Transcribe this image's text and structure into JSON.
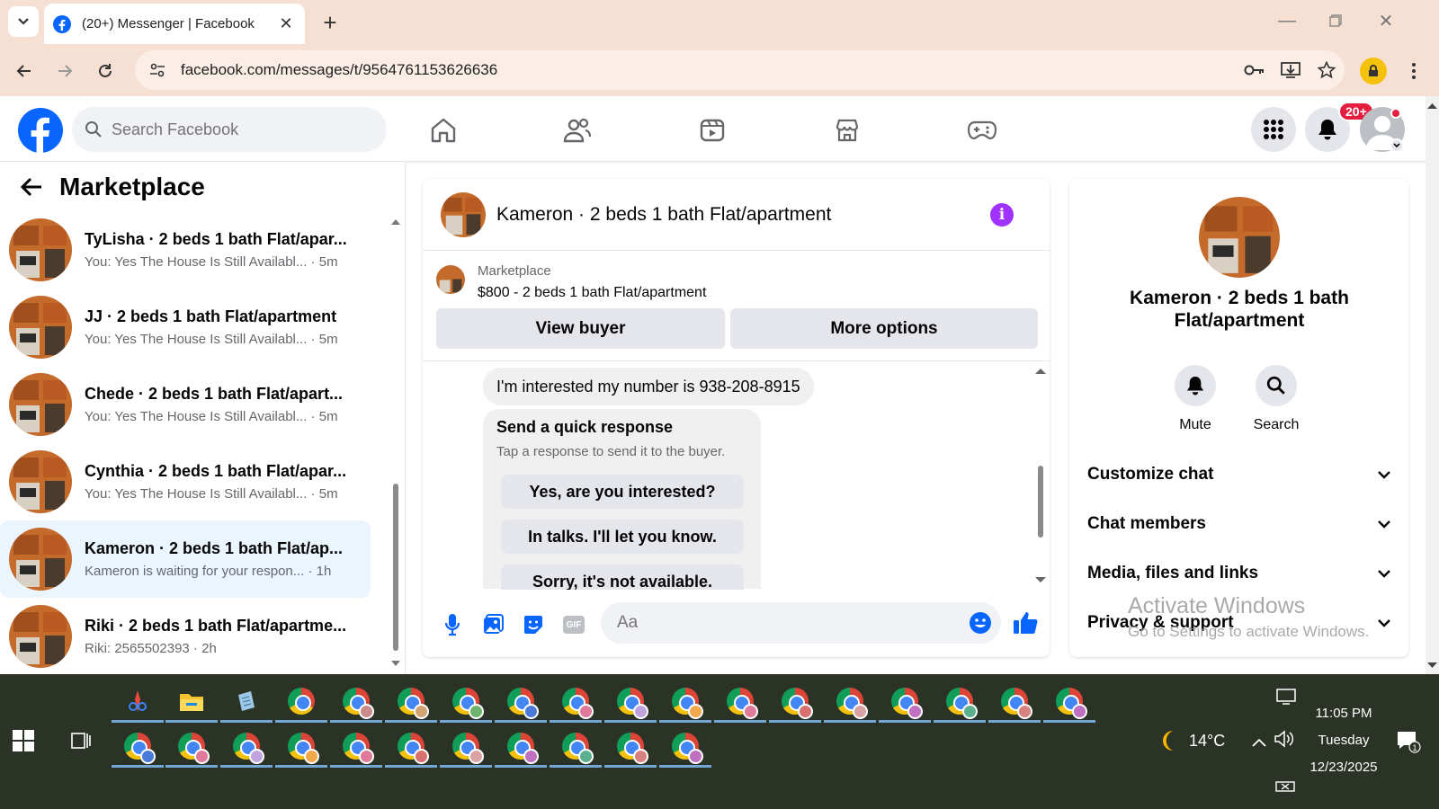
{
  "browser": {
    "tab_title": "(20+) Messenger | Facebook",
    "url": "facebook.com/messages/t/9564761153626636"
  },
  "fb_header": {
    "search_placeholder": "Search Facebook",
    "notification_badge": "20+"
  },
  "left_panel": {
    "title": "Marketplace",
    "conversations": [
      {
        "name": "TyLisha · 2 beds 1 bath Flat/apar...",
        "preview": "You: Yes The House Is Still Availabl...",
        "time": "5m"
      },
      {
        "name": "JJ · 2 beds 1 bath Flat/apartment",
        "preview": "You: Yes The House Is Still Availabl...",
        "time": "5m"
      },
      {
        "name": "Chede · 2 beds 1 bath Flat/apart...",
        "preview": "You: Yes The House Is Still Availabl...",
        "time": "5m"
      },
      {
        "name": "Cynthia · 2 beds 1 bath Flat/apar...",
        "preview": "You: Yes The House Is Still Availabl...",
        "time": "5m"
      },
      {
        "name": "Kameron · 2 beds 1 bath Flat/ap...",
        "preview": "Kameron is waiting for your respon...",
        "time": "1h"
      },
      {
        "name": "Riki · 2 beds 1 bath Flat/apartme...",
        "preview": "Riki: 2565502393",
        "time": "2h"
      }
    ]
  },
  "chat": {
    "title": "Kameron · 2 beds 1 bath Flat/apartment",
    "marketplace_label": "Marketplace",
    "listing": "$800 - 2 beds 1 bath Flat/apartment",
    "view_buyer": "View buyer",
    "more_options": "More options",
    "message": "I'm interested my number is 938-208-8915",
    "quick_response_title": "Send a quick response",
    "quick_response_sub": "Tap a response to send it to the buyer.",
    "quick_responses": [
      "Yes, are you interested?",
      "In talks. I'll let you know.",
      "Sorry, it's not available."
    ],
    "input_placeholder": "Aa",
    "gif_label": "GIF"
  },
  "right_panel": {
    "name": "Kameron · 2 beds 1 bath Flat/apartment",
    "mute": "Mute",
    "search": "Search",
    "sections": [
      "Customize chat",
      "Chat members",
      "Media, files and links",
      "Privacy & support"
    ]
  },
  "watermark": {
    "line1": "Activate Windows",
    "line2": "Go to Settings to activate Windows."
  },
  "taskbar": {
    "weather": "14°C",
    "time": "11:05 PM",
    "day": "Tuesday",
    "date": "12/23/2025",
    "badge_colors": [
      "#c98a8a",
      "#d4a373",
      "#6db36d",
      "#4a7bd8",
      "#e07a9b",
      "#c1a3e0",
      "#f2a84b",
      "#e07a9b",
      "#d97070",
      "#d9a3a3",
      "#c070c0",
      "#5bb08f",
      "#d98080",
      "#c070c0"
    ]
  },
  "colors": {
    "fb_blue": "#0866ff",
    "accent_purple": "#a033ff",
    "active_row": "#ebf5ff"
  }
}
